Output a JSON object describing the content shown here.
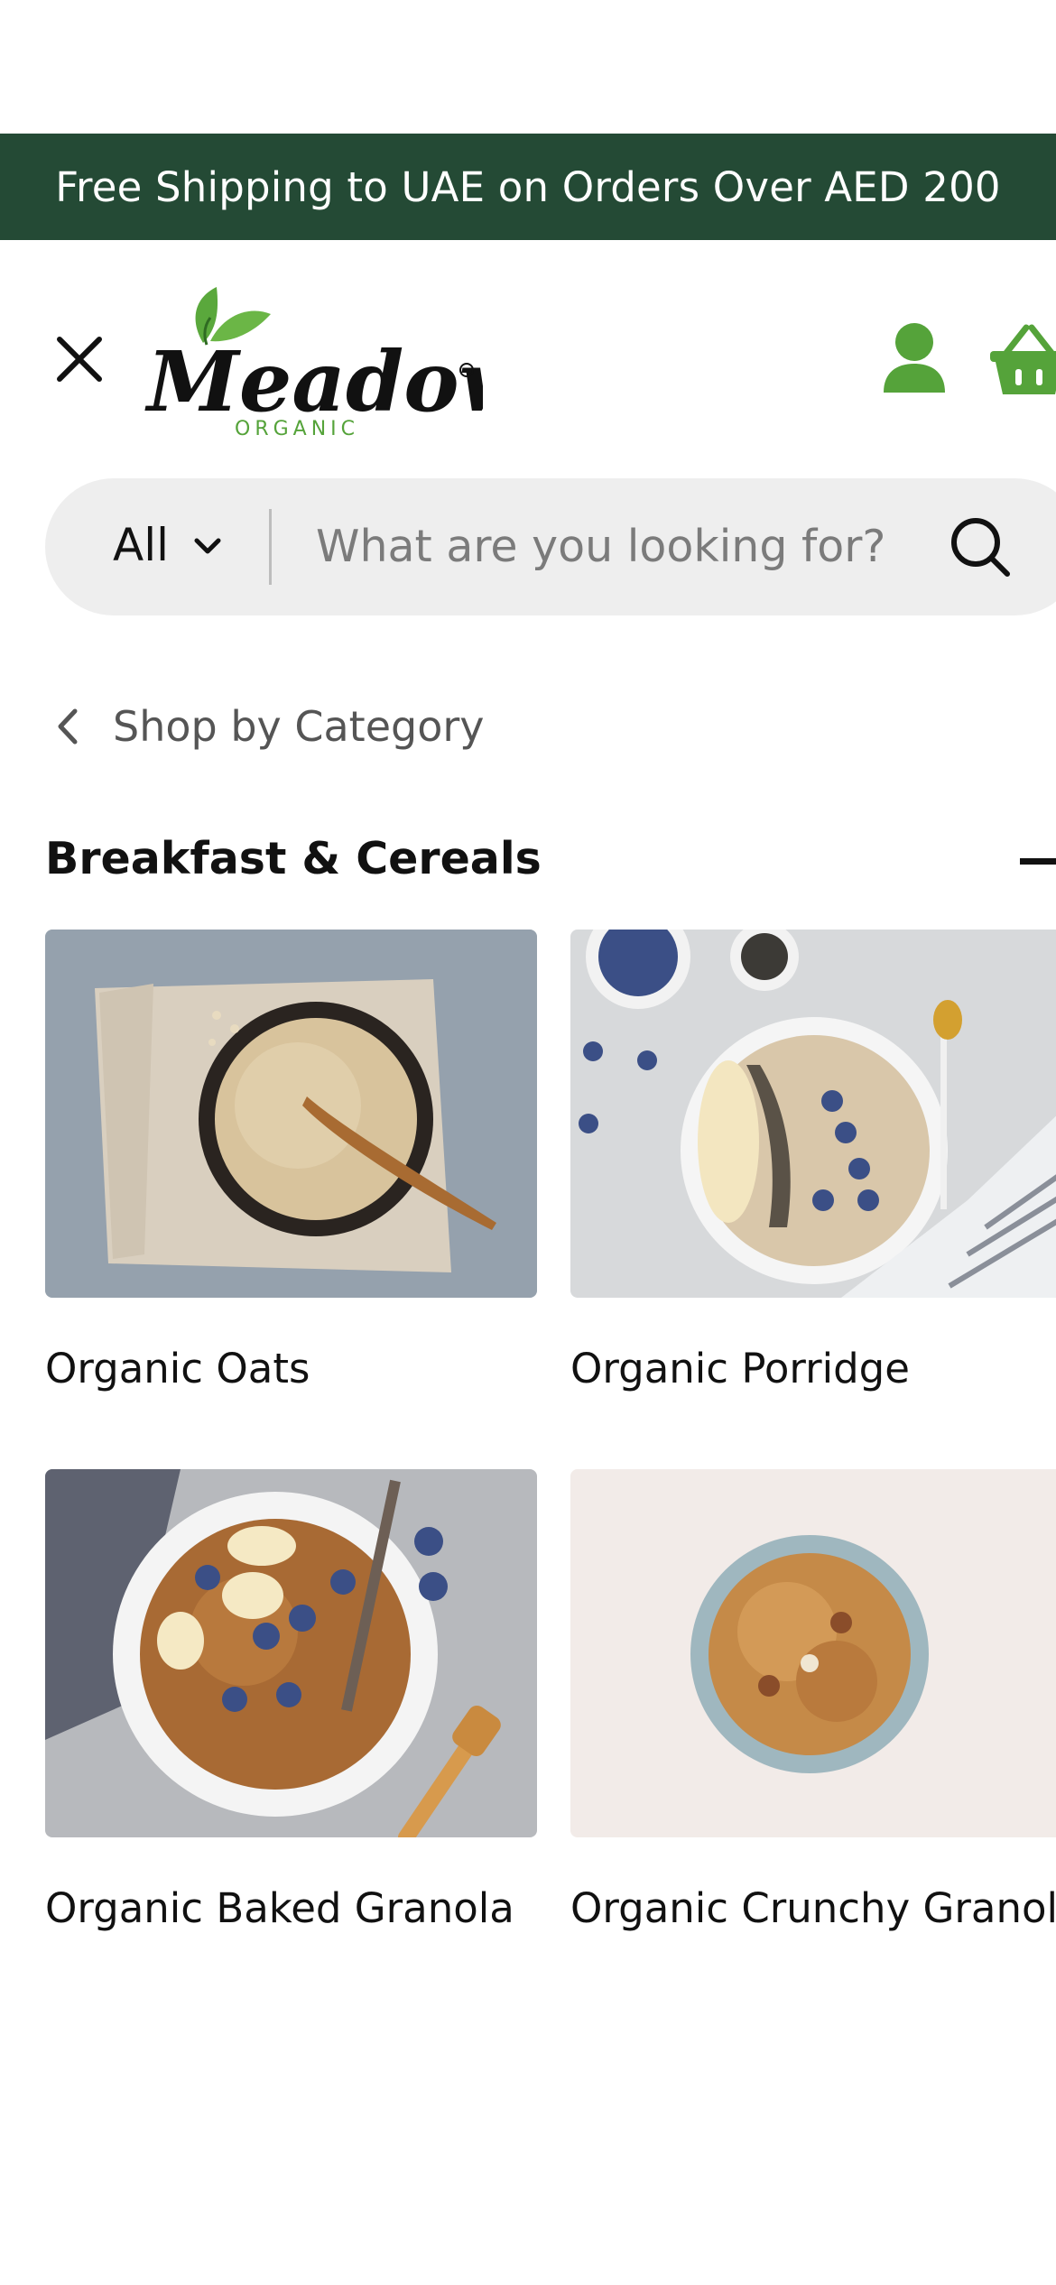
{
  "banner": {
    "text": "Free Shipping to UAE on Orders Over AED 200"
  },
  "header": {
    "brand_name": "Meadows",
    "brand_subtitle": "ORGANIC",
    "close_icon": "close-icon",
    "account_icon": "user-icon",
    "cart_icon": "basket-icon",
    "brand_color": "#55a33a"
  },
  "search": {
    "category": "All",
    "placeholder": "What are you looking for?"
  },
  "nav": {
    "back_label": "Shop by Category"
  },
  "category": {
    "title": "Breakfast & Cereals",
    "items": [
      {
        "label": "Organic Oats"
      },
      {
        "label": "Organic Porridge"
      },
      {
        "label": "Organic Baked Granola"
      },
      {
        "label": "Organic Crunchy Granola"
      }
    ]
  },
  "colors": {
    "banner_bg": "#244a35",
    "accent_green": "#55a33a"
  }
}
